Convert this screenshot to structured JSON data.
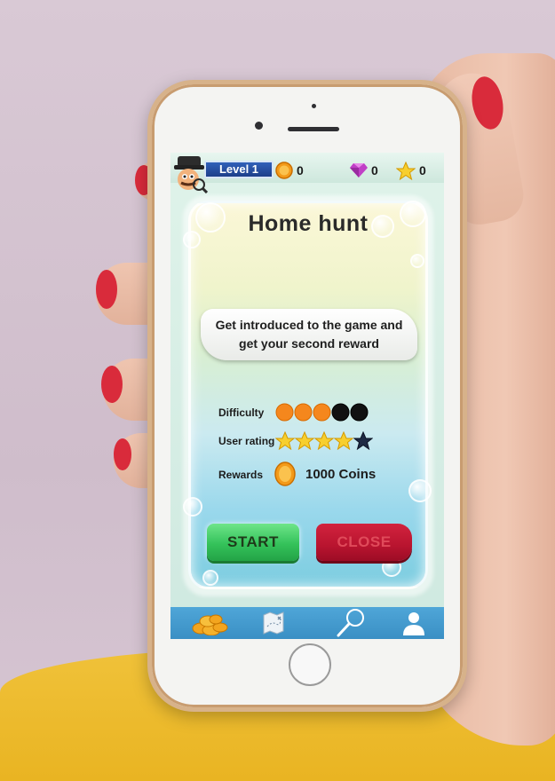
{
  "header": {
    "level_label": "Level 1",
    "coins": "0",
    "gems": "0",
    "stars": "0"
  },
  "dialog": {
    "title": "Home hunt",
    "description": "Get introduced to the game and get your second reward",
    "difficulty_label": "Difficulty",
    "difficulty": {
      "level": 3,
      "max": 5
    },
    "rating_label": "User rating",
    "rating": {
      "value": 4,
      "max": 5
    },
    "rewards_label": "Rewards",
    "rewards_value": "1000 Coins",
    "start_label": "START",
    "close_label": "CLOSE"
  },
  "navbar": {
    "items": [
      {
        "icon": "coins-pile-icon"
      },
      {
        "icon": "treasure-map-icon"
      },
      {
        "icon": "magnifier-icon"
      },
      {
        "icon": "profile-icon"
      }
    ]
  },
  "colors": {
    "accent_blue": "#1d3f8a",
    "start_green": "#34c25a",
    "close_red": "#b8142f",
    "navbar_blue": "#3a8fc4",
    "coin_orange": "#f39a1a"
  }
}
